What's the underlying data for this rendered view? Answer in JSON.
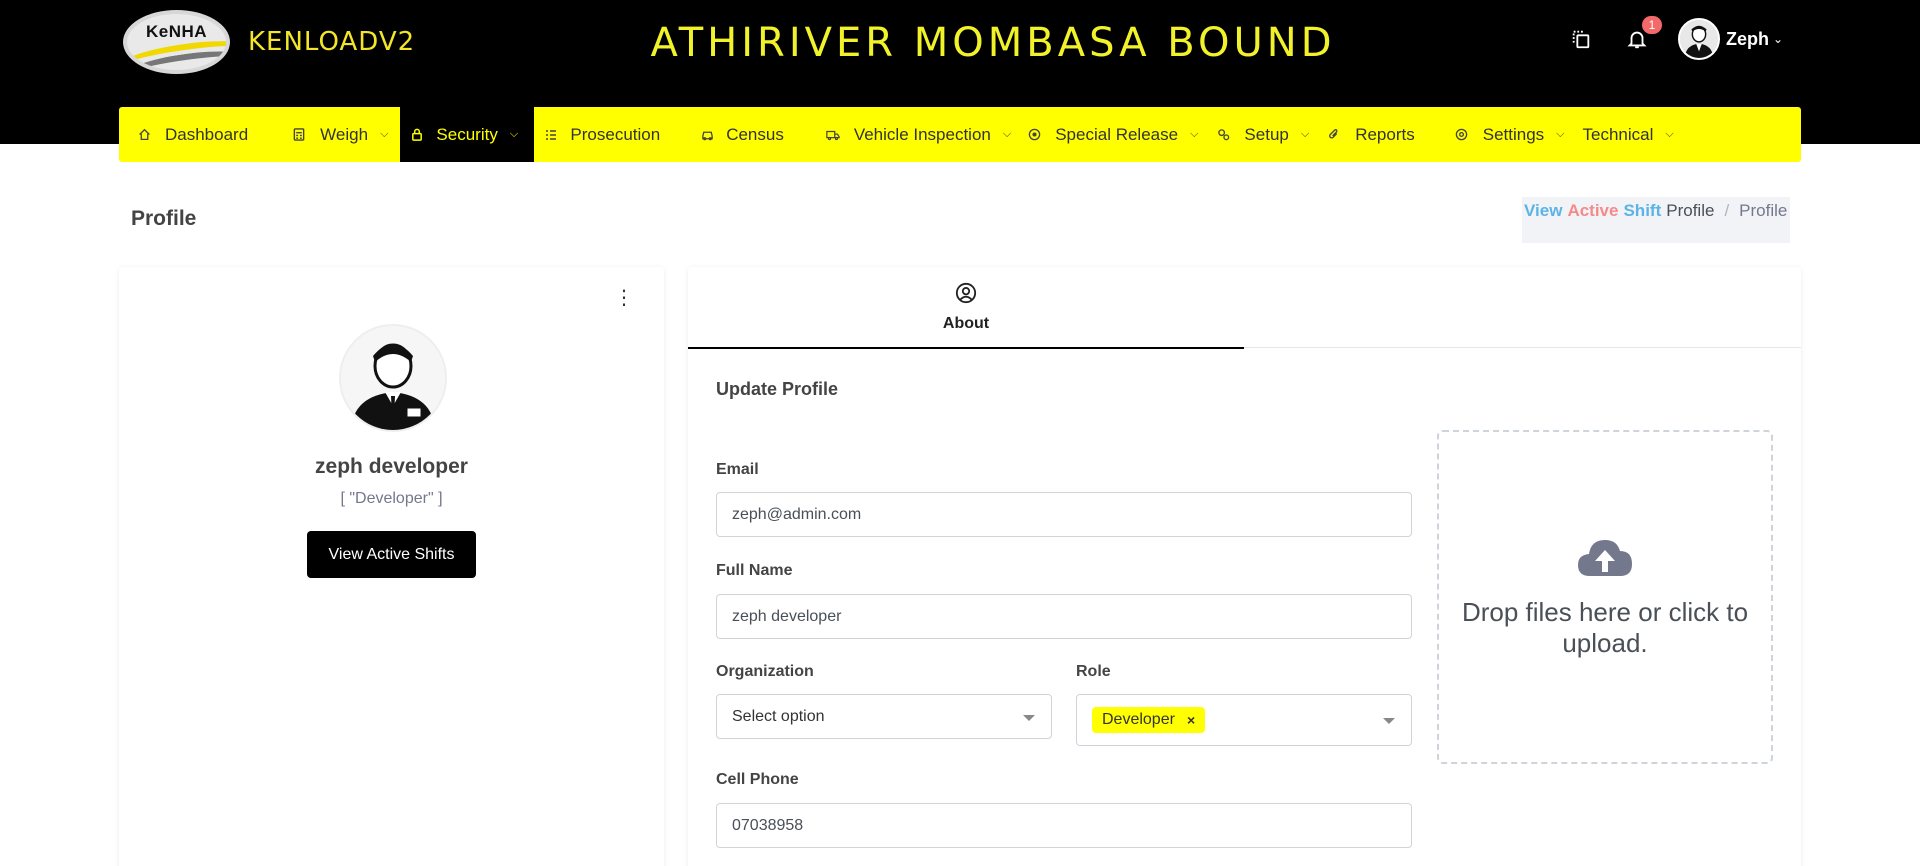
{
  "header": {
    "logo_text": "KeNHA",
    "brand": "KENLOADV2",
    "station_title": "ATHIRIVER MOMBASA BOUND",
    "notification_count": "1",
    "user_name": "Zeph"
  },
  "nav": {
    "items": [
      {
        "label": "Dashboard",
        "icon": "home-icon",
        "has_dropdown": false
      },
      {
        "label": "Weigh",
        "icon": "calculator-icon",
        "has_dropdown": true
      },
      {
        "label": "Security",
        "icon": "lock-icon",
        "has_dropdown": true,
        "active": true
      },
      {
        "label": "Prosecution",
        "icon": "list-icon",
        "has_dropdown": false
      },
      {
        "label": "Census",
        "icon": "car-icon",
        "has_dropdown": false
      },
      {
        "label": "Vehicle Inspection",
        "icon": "truck-icon",
        "has_dropdown": true
      },
      {
        "label": "Special Release",
        "icon": "target-icon",
        "has_dropdown": true
      },
      {
        "label": "Setup",
        "icon": "cogs-icon",
        "has_dropdown": true
      },
      {
        "label": "Reports",
        "icon": "paperclip-icon",
        "has_dropdown": false
      },
      {
        "label": "Settings",
        "icon": "gear-icon",
        "has_dropdown": true
      },
      {
        "label": "Technical",
        "icon": "",
        "has_dropdown": true
      }
    ]
  },
  "page": {
    "title": "Profile",
    "breadcrumb": {
      "view": "View",
      "active": "Active",
      "shift": "Shift",
      "profile": "Profile",
      "separator": "/",
      "current": "Profile"
    }
  },
  "profile_card": {
    "name": "zeph developer",
    "roles": "[ \"Developer\" ]",
    "button_label": "View Active Shifts"
  },
  "about": {
    "tab_label": "About",
    "section_title": "Update Profile",
    "email": {
      "label": "Email",
      "value": "zeph@admin.com"
    },
    "full_name": {
      "label": "Full Name",
      "value": "zeph developer"
    },
    "organization": {
      "label": "Organization",
      "value": "Select option"
    },
    "role": {
      "label": "Role",
      "tag": "Developer",
      "remove": "×"
    },
    "cell_phone": {
      "label": "Cell Phone",
      "value": "07038958"
    },
    "dropzone_text": "Drop files here or click to upload."
  },
  "colors": {
    "accent_yellow": "#ffff00",
    "header_bg": "#000000",
    "title_yellow": "#f2f22a",
    "badge_red": "#f46a6a"
  }
}
